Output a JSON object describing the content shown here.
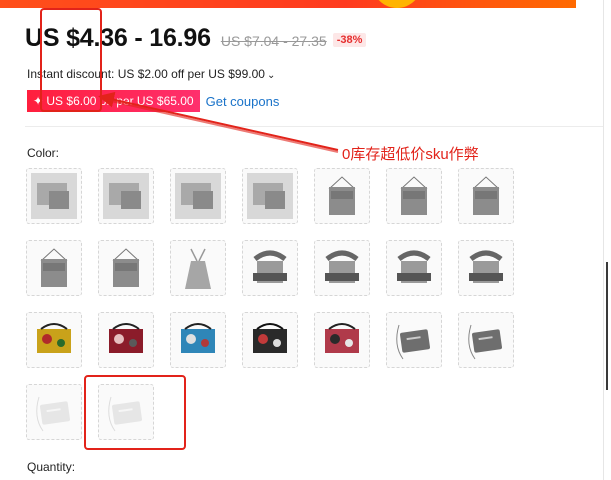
{
  "price": {
    "main": "US $4.36 - 16.96",
    "original": "US $7.04 - 27.35",
    "discount_badge": "-38%"
  },
  "instant_discount": {
    "text": "Instant discount: US $2.00 off per US $99.00",
    "chevron": "⌄"
  },
  "coupon": {
    "badge": "✦ US $6.00 off per US $65.00",
    "link": "Get coupons"
  },
  "color_label": "Color:",
  "quantity_label": "Quantity:",
  "annotation": "0库存超低价sku作弊",
  "swatches": [
    {
      "style": "grey-photo"
    },
    {
      "style": "grey-photo"
    },
    {
      "style": "grey-photo"
    },
    {
      "style": "grey-photo"
    },
    {
      "style": "grey-envelope"
    },
    {
      "style": "grey-envelope"
    },
    {
      "style": "grey-envelope"
    },
    {
      "style": "grey-envelope"
    },
    {
      "style": "grey-envelope"
    },
    {
      "style": "grey-tote"
    },
    {
      "style": "strap-bag"
    },
    {
      "style": "strap-bag"
    },
    {
      "style": "strap-bag"
    },
    {
      "style": "strap-bag"
    },
    {
      "style": "floral-yellow"
    },
    {
      "style": "floral-red"
    },
    {
      "style": "floral-blue"
    },
    {
      "style": "floral-black"
    },
    {
      "style": "floral-pink"
    },
    {
      "style": "plain-bag"
    },
    {
      "style": "plain-bag"
    },
    {
      "style": "plain-bag-light"
    },
    {
      "style": "plain-bag-light"
    }
  ],
  "colors": {
    "accent_red": "#e2231a",
    "link_blue": "#1a73c9",
    "coupon_pink": "#ff2f6d"
  }
}
